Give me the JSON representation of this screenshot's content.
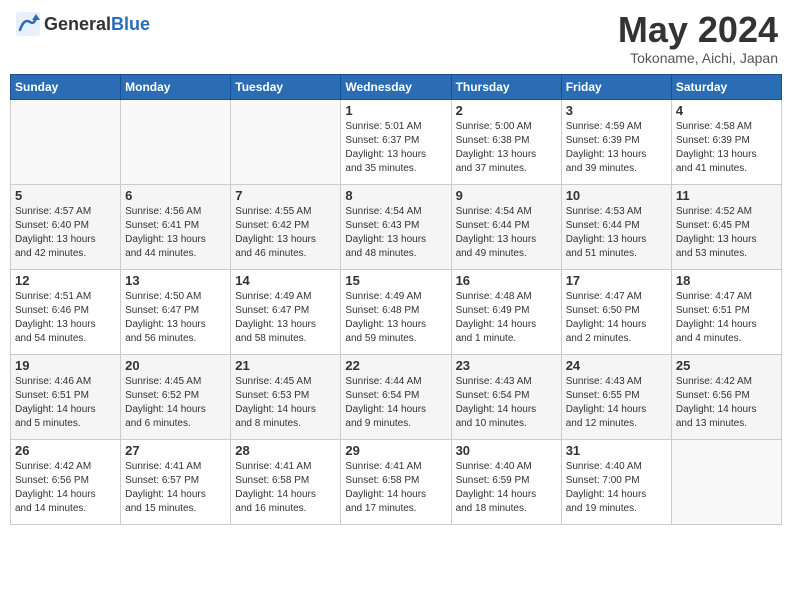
{
  "header": {
    "logo_general": "General",
    "logo_blue": "Blue",
    "month_title": "May 2024",
    "location": "Tokoname, Aichi, Japan"
  },
  "weekdays": [
    "Sunday",
    "Monday",
    "Tuesday",
    "Wednesday",
    "Thursday",
    "Friday",
    "Saturday"
  ],
  "weeks": [
    [
      {
        "day": "",
        "info": ""
      },
      {
        "day": "",
        "info": ""
      },
      {
        "day": "",
        "info": ""
      },
      {
        "day": "1",
        "info": "Sunrise: 5:01 AM\nSunset: 6:37 PM\nDaylight: 13 hours\nand 35 minutes."
      },
      {
        "day": "2",
        "info": "Sunrise: 5:00 AM\nSunset: 6:38 PM\nDaylight: 13 hours\nand 37 minutes."
      },
      {
        "day": "3",
        "info": "Sunrise: 4:59 AM\nSunset: 6:39 PM\nDaylight: 13 hours\nand 39 minutes."
      },
      {
        "day": "4",
        "info": "Sunrise: 4:58 AM\nSunset: 6:39 PM\nDaylight: 13 hours\nand 41 minutes."
      }
    ],
    [
      {
        "day": "5",
        "info": "Sunrise: 4:57 AM\nSunset: 6:40 PM\nDaylight: 13 hours\nand 42 minutes."
      },
      {
        "day": "6",
        "info": "Sunrise: 4:56 AM\nSunset: 6:41 PM\nDaylight: 13 hours\nand 44 minutes."
      },
      {
        "day": "7",
        "info": "Sunrise: 4:55 AM\nSunset: 6:42 PM\nDaylight: 13 hours\nand 46 minutes."
      },
      {
        "day": "8",
        "info": "Sunrise: 4:54 AM\nSunset: 6:43 PM\nDaylight: 13 hours\nand 48 minutes."
      },
      {
        "day": "9",
        "info": "Sunrise: 4:54 AM\nSunset: 6:44 PM\nDaylight: 13 hours\nand 49 minutes."
      },
      {
        "day": "10",
        "info": "Sunrise: 4:53 AM\nSunset: 6:44 PM\nDaylight: 13 hours\nand 51 minutes."
      },
      {
        "day": "11",
        "info": "Sunrise: 4:52 AM\nSunset: 6:45 PM\nDaylight: 13 hours\nand 53 minutes."
      }
    ],
    [
      {
        "day": "12",
        "info": "Sunrise: 4:51 AM\nSunset: 6:46 PM\nDaylight: 13 hours\nand 54 minutes."
      },
      {
        "day": "13",
        "info": "Sunrise: 4:50 AM\nSunset: 6:47 PM\nDaylight: 13 hours\nand 56 minutes."
      },
      {
        "day": "14",
        "info": "Sunrise: 4:49 AM\nSunset: 6:47 PM\nDaylight: 13 hours\nand 58 minutes."
      },
      {
        "day": "15",
        "info": "Sunrise: 4:49 AM\nSunset: 6:48 PM\nDaylight: 13 hours\nand 59 minutes."
      },
      {
        "day": "16",
        "info": "Sunrise: 4:48 AM\nSunset: 6:49 PM\nDaylight: 14 hours\nand 1 minute."
      },
      {
        "day": "17",
        "info": "Sunrise: 4:47 AM\nSunset: 6:50 PM\nDaylight: 14 hours\nand 2 minutes."
      },
      {
        "day": "18",
        "info": "Sunrise: 4:47 AM\nSunset: 6:51 PM\nDaylight: 14 hours\nand 4 minutes."
      }
    ],
    [
      {
        "day": "19",
        "info": "Sunrise: 4:46 AM\nSunset: 6:51 PM\nDaylight: 14 hours\nand 5 minutes."
      },
      {
        "day": "20",
        "info": "Sunrise: 4:45 AM\nSunset: 6:52 PM\nDaylight: 14 hours\nand 6 minutes."
      },
      {
        "day": "21",
        "info": "Sunrise: 4:45 AM\nSunset: 6:53 PM\nDaylight: 14 hours\nand 8 minutes."
      },
      {
        "day": "22",
        "info": "Sunrise: 4:44 AM\nSunset: 6:54 PM\nDaylight: 14 hours\nand 9 minutes."
      },
      {
        "day": "23",
        "info": "Sunrise: 4:43 AM\nSunset: 6:54 PM\nDaylight: 14 hours\nand 10 minutes."
      },
      {
        "day": "24",
        "info": "Sunrise: 4:43 AM\nSunset: 6:55 PM\nDaylight: 14 hours\nand 12 minutes."
      },
      {
        "day": "25",
        "info": "Sunrise: 4:42 AM\nSunset: 6:56 PM\nDaylight: 14 hours\nand 13 minutes."
      }
    ],
    [
      {
        "day": "26",
        "info": "Sunrise: 4:42 AM\nSunset: 6:56 PM\nDaylight: 14 hours\nand 14 minutes."
      },
      {
        "day": "27",
        "info": "Sunrise: 4:41 AM\nSunset: 6:57 PM\nDaylight: 14 hours\nand 15 minutes."
      },
      {
        "day": "28",
        "info": "Sunrise: 4:41 AM\nSunset: 6:58 PM\nDaylight: 14 hours\nand 16 minutes."
      },
      {
        "day": "29",
        "info": "Sunrise: 4:41 AM\nSunset: 6:58 PM\nDaylight: 14 hours\nand 17 minutes."
      },
      {
        "day": "30",
        "info": "Sunrise: 4:40 AM\nSunset: 6:59 PM\nDaylight: 14 hours\nand 18 minutes."
      },
      {
        "day": "31",
        "info": "Sunrise: 4:40 AM\nSunset: 7:00 PM\nDaylight: 14 hours\nand 19 minutes."
      },
      {
        "day": "",
        "info": ""
      }
    ]
  ]
}
